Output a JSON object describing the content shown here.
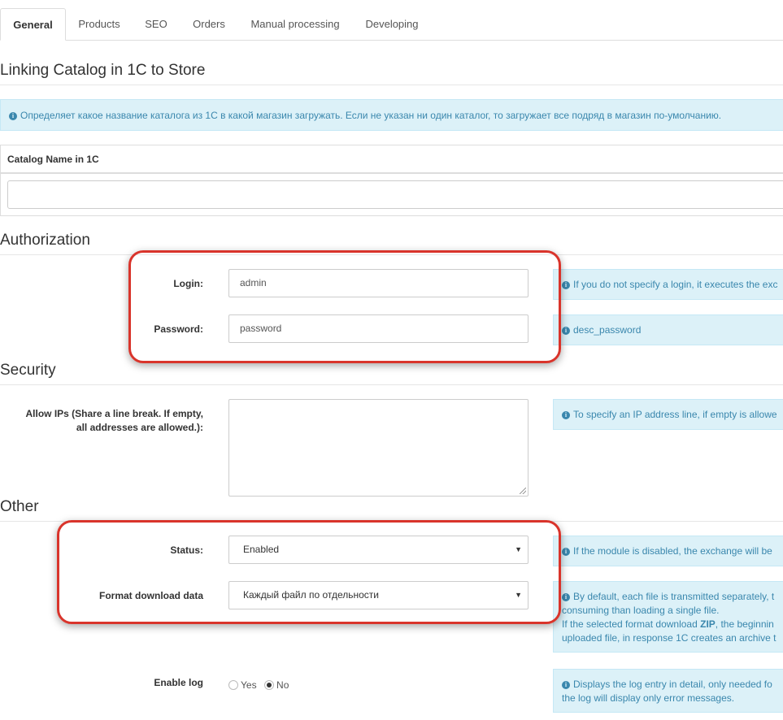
{
  "tabs": [
    {
      "label": "General",
      "active": true
    },
    {
      "label": "Products"
    },
    {
      "label": "SEO"
    },
    {
      "label": "Orders"
    },
    {
      "label": "Manual processing"
    },
    {
      "label": "Developing"
    }
  ],
  "linking": {
    "title": "Linking Catalog in 1C to Store",
    "info": "Определяет какое название каталога из 1С в какой магазин загружать. Если не указан ни один каталог, то загружает все подряд в магазин по-умолчанию.",
    "column_header": "Catalog Name in 1C",
    "value": ""
  },
  "authorization": {
    "title": "Authorization",
    "login_label": "Login:",
    "login_value": "admin",
    "login_hint": "If you do not specify a login, it executes the exc",
    "password_label": "Password:",
    "password_value": "password",
    "password_hint": "desc_password"
  },
  "security": {
    "title": "Security",
    "allow_ips_label_1": "Allow IPs (Share a line break. If empty,",
    "allow_ips_label_2": "all addresses are allowed.):",
    "allow_ips_hint": "To specify an IP address line, if empty is allowe"
  },
  "other": {
    "title": "Other",
    "status_label": "Status:",
    "status_value": "Enabled",
    "status_hint": "If the module is disabled, the exchange will be",
    "format_label": "Format download data",
    "format_value": "Каждый файл по отдельности",
    "format_hint_1": "By default, each file is transmitted separately, t",
    "format_hint_2": "consuming than loading a single file.",
    "format_hint_3a": "If the selected format download ",
    "format_hint_3b": "ZIP",
    "format_hint_3c": ", the beginnin",
    "format_hint_4": "uploaded file, in response 1C creates an archive t",
    "log_label": "Enable log",
    "log_yes": "Yes",
    "log_no": "No",
    "log_selected": "No",
    "log_hint_1": "Displays the log entry in detail, only needed fo",
    "log_hint_2": "the log will display only error messages."
  },
  "colors": {
    "accent_callout": "#d9342b",
    "info_bg": "#dcf1f8",
    "info_text": "#3a87ad"
  }
}
